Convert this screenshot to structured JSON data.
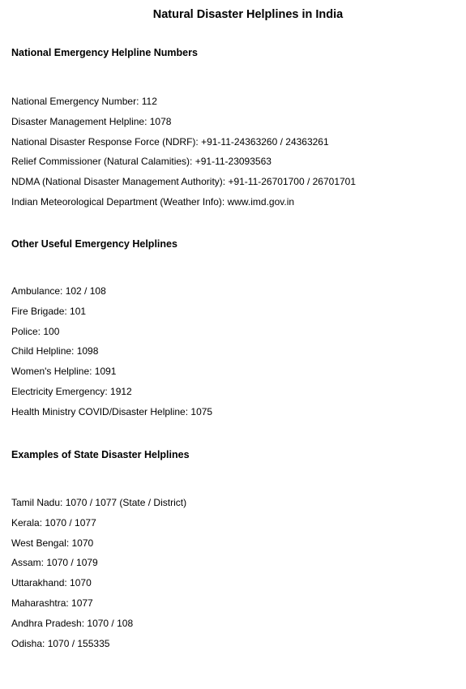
{
  "title": "Natural Disaster Helplines in India",
  "sections": [
    {
      "heading": "National Emergency Helpline Numbers",
      "items": [
        "National Emergency Number: 112",
        "Disaster Management Helpline: 1078",
        "National Disaster Response Force (NDRF): +91-11-24363260 / 24363261",
        "Relief Commissioner (Natural Calamities): +91-11-23093563",
        "NDMA (National Disaster Management Authority): +91-11-26701700 / 26701701",
        "Indian Meteorological Department (Weather Info): www.imd.gov.in"
      ]
    },
    {
      "heading": "Other Useful Emergency Helplines",
      "items": [
        "Ambulance: 102 / 108",
        "Fire Brigade: 101",
        "Police: 100",
        "Child Helpline: 1098",
        "Women's Helpline: 1091",
        "Electricity Emergency: 1912",
        "Health Ministry COVID/Disaster Helpline: 1075"
      ]
    },
    {
      "heading": "Examples of State Disaster Helplines",
      "items": [
        "Tamil Nadu: 1070 / 1077 (State / District)",
        "Kerala: 1070 / 1077",
        "West Bengal: 1070",
        "Assam: 1070 / 1079",
        "Uttarakhand: 1070",
        "Maharashtra: 1077",
        "Andhra Pradesh: 1070 / 108",
        "Odisha: 1070 / 155335"
      ]
    }
  ]
}
